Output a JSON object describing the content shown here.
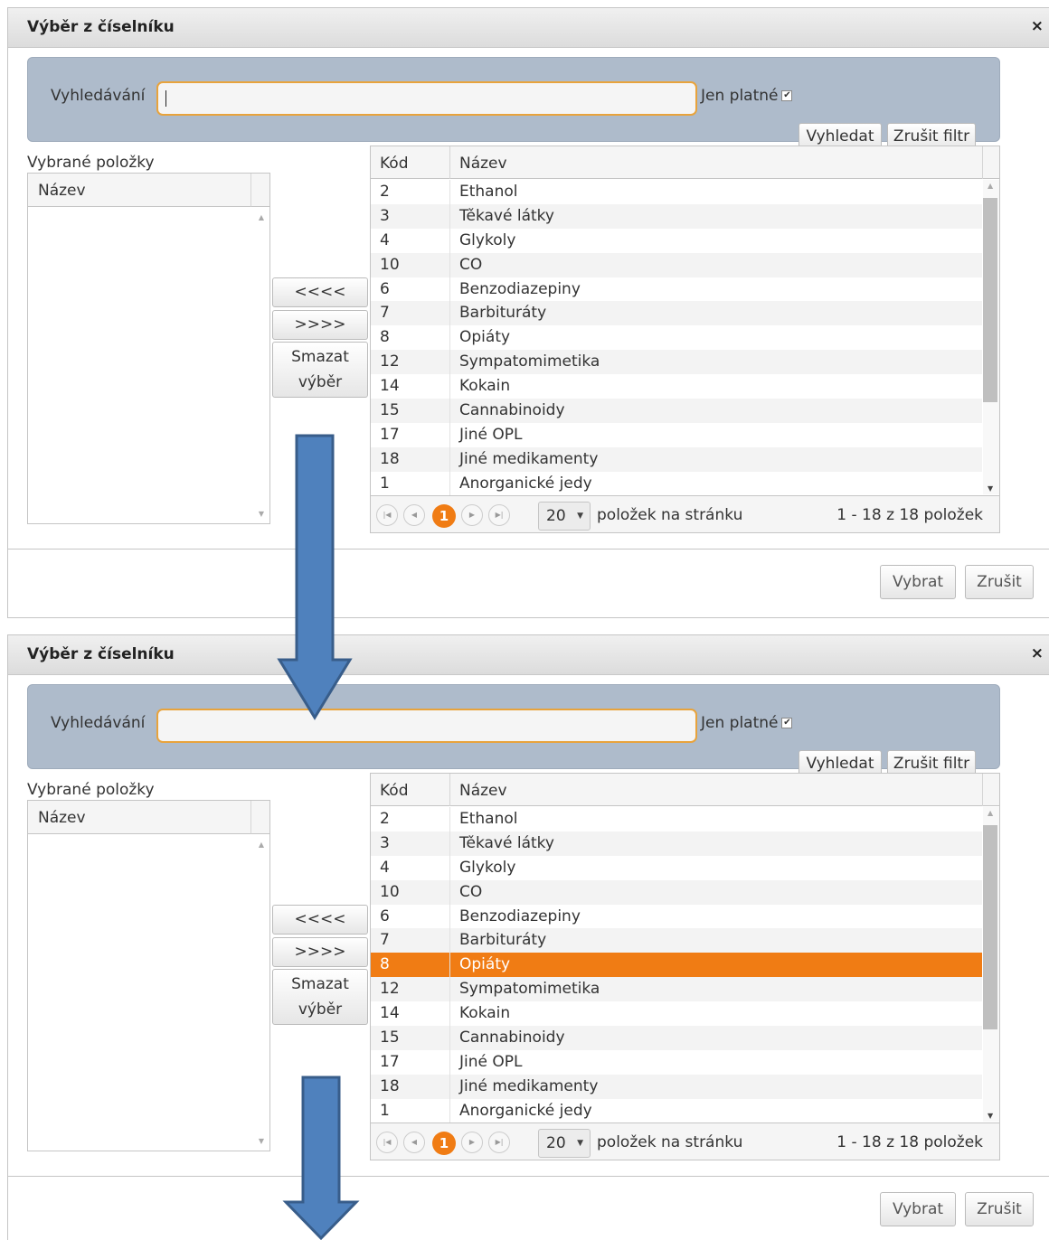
{
  "dialogs": [
    {
      "title": "Výběr z číselníku",
      "close_glyph": "×",
      "search": {
        "label": "Vyhledávání",
        "value": "",
        "jen_platne_label": "Jen platné",
        "jen_platne_checked": true,
        "search_button": "Vyhledat",
        "clear_filter_button": "Zrušit filtr"
      },
      "selected": {
        "label": "Vybrané položky",
        "column": "Název"
      },
      "transfer_buttons": {
        "remove_all": "<<<<",
        "add": ">>>>",
        "clear_line1": "Smazat",
        "clear_line2": "výběr"
      },
      "grid": {
        "columns": [
          "Kód",
          "Název"
        ],
        "rows": [
          {
            "code": "2",
            "name": "Ethanol"
          },
          {
            "code": "3",
            "name": "Těkavé látky"
          },
          {
            "code": "4",
            "name": "Glykoly"
          },
          {
            "code": "10",
            "name": "CO"
          },
          {
            "code": "6",
            "name": "Benzodiazepiny"
          },
          {
            "code": "7",
            "name": "Barbituráty"
          },
          {
            "code": "8",
            "name": "Opiáty"
          },
          {
            "code": "12",
            "name": "Sympatomimetika"
          },
          {
            "code": "14",
            "name": "Kokain"
          },
          {
            "code": "15",
            "name": "Cannabinoidy"
          },
          {
            "code": "17",
            "name": "Jiné OPL"
          },
          {
            "code": "18",
            "name": "Jiné medikamenty"
          },
          {
            "code": "1",
            "name": "Anorganické jedy"
          }
        ],
        "selected_row": null,
        "pager": {
          "current_page": "1",
          "page_size": "20",
          "per_page_label": "položek na stránku",
          "info": "1 - 18 z 18 položek"
        }
      },
      "footer": {
        "select_button": "Vybrat",
        "cancel_button": "Zrušit"
      }
    },
    {
      "title": "Výběr z číselníku",
      "close_glyph": "×",
      "search": {
        "label": "Vyhledávání",
        "value": "",
        "jen_platne_label": "Jen platné",
        "jen_platne_checked": true,
        "search_button": "Vyhledat",
        "clear_filter_button": "Zrušit filtr"
      },
      "selected": {
        "label": "Vybrané položky",
        "column": "Název"
      },
      "transfer_buttons": {
        "remove_all": "<<<<",
        "add": ">>>>",
        "clear_line1": "Smazat",
        "clear_line2": "výběr"
      },
      "grid": {
        "columns": [
          "Kód",
          "Název"
        ],
        "rows": [
          {
            "code": "2",
            "name": "Ethanol"
          },
          {
            "code": "3",
            "name": "Těkavé látky"
          },
          {
            "code": "4",
            "name": "Glykoly"
          },
          {
            "code": "10",
            "name": "CO"
          },
          {
            "code": "6",
            "name": "Benzodiazepiny"
          },
          {
            "code": "7",
            "name": "Barbituráty"
          },
          {
            "code": "8",
            "name": "Opiáty"
          },
          {
            "code": "12",
            "name": "Sympatomimetika"
          },
          {
            "code": "14",
            "name": "Kokain"
          },
          {
            "code": "15",
            "name": "Cannabinoidy"
          },
          {
            "code": "17",
            "name": "Jiné OPL"
          },
          {
            "code": "18",
            "name": "Jiné medikamenty"
          },
          {
            "code": "1",
            "name": "Anorganické jedy"
          }
        ],
        "selected_row": 6,
        "pager": {
          "current_page": "1",
          "page_size": "20",
          "per_page_label": "položek na stránku",
          "info": "1 - 18 z 18 položek"
        }
      },
      "footer": {
        "select_button": "Vybrat",
        "cancel_button": "Zrušit"
      }
    }
  ],
  "colors": {
    "accent": "#f07c14",
    "search_panel": "#aebbcb",
    "arrow": "#4f81bd",
    "arrow_border": "#385d8a"
  },
  "icons": {
    "checkbox": "checkmark-icon",
    "close": "close-icon",
    "flow_arrow": "down-arrow-icon"
  }
}
